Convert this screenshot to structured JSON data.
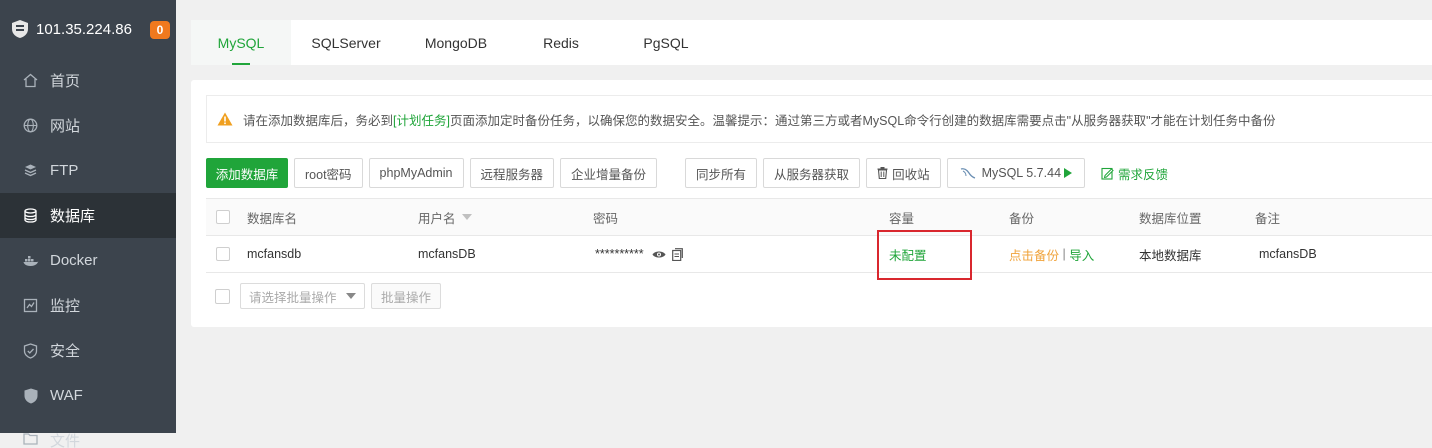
{
  "sidebar": {
    "server_ip": "101.35.224.86",
    "badge_count": "0",
    "items": [
      {
        "label": "首页",
        "icon": "home-icon"
      },
      {
        "label": "网站",
        "icon": "globe-icon"
      },
      {
        "label": "FTP",
        "icon": "ftp-icon"
      },
      {
        "label": "数据库",
        "icon": "database-icon",
        "active": true
      },
      {
        "label": "Docker",
        "icon": "docker-icon"
      },
      {
        "label": "监控",
        "icon": "monitor-icon"
      },
      {
        "label": "安全",
        "icon": "shield-icon"
      },
      {
        "label": "WAF",
        "icon": "waf-shield-icon"
      },
      {
        "label": "文件",
        "icon": "folder-icon"
      }
    ]
  },
  "tabs": [
    {
      "label": "MySQL",
      "active": true
    },
    {
      "label": "SQLServer"
    },
    {
      "label": "MongoDB"
    },
    {
      "label": "Redis"
    },
    {
      "label": "PgSQL"
    }
  ],
  "notice": {
    "prefix": "请在添加数据库后，务必到",
    "link": "[计划任务]",
    "suffix": "页面添加定时备份任务，以确保您的数据安全。温馨提示：通过第三方或者MySQL命令行创建的数据库需要点击\"从服务器获取\"才能在计划任务中备份"
  },
  "toolbar": {
    "add_db": "添加数据库",
    "root_pw": "root密码",
    "phpmyadmin": "phpMyAdmin",
    "remote_server": "远程服务器",
    "incremental_backup": "企业增量备份",
    "sync_all": "同步所有",
    "fetch_from_server": "从服务器获取",
    "recycle_bin": "回收站",
    "mysql_version": "MySQL 5.7.44",
    "feedback": "需求反馈"
  },
  "table": {
    "headers": {
      "name": "数据库名",
      "user": "用户名",
      "password": "密码",
      "capacity": "容量",
      "backup": "备份",
      "location": "数据库位置",
      "note": "备注"
    },
    "rows": [
      {
        "name": "mcfansdb",
        "user": "mcfansDB",
        "password": "**********",
        "capacity": "未配置",
        "backup_action": "点击备份",
        "backup_sep": " | ",
        "import_action": "导入",
        "location": "本地数据库",
        "note": "mcfansDB"
      }
    ]
  },
  "batch": {
    "select_placeholder": "请选择批量操作",
    "button": "批量操作"
  },
  "colors": {
    "accent": "#20a53a",
    "sidebar_bg": "#3c444d",
    "highlight": "#d9272e",
    "badge": "#f0791e",
    "backup_link": "#f0a33b"
  }
}
